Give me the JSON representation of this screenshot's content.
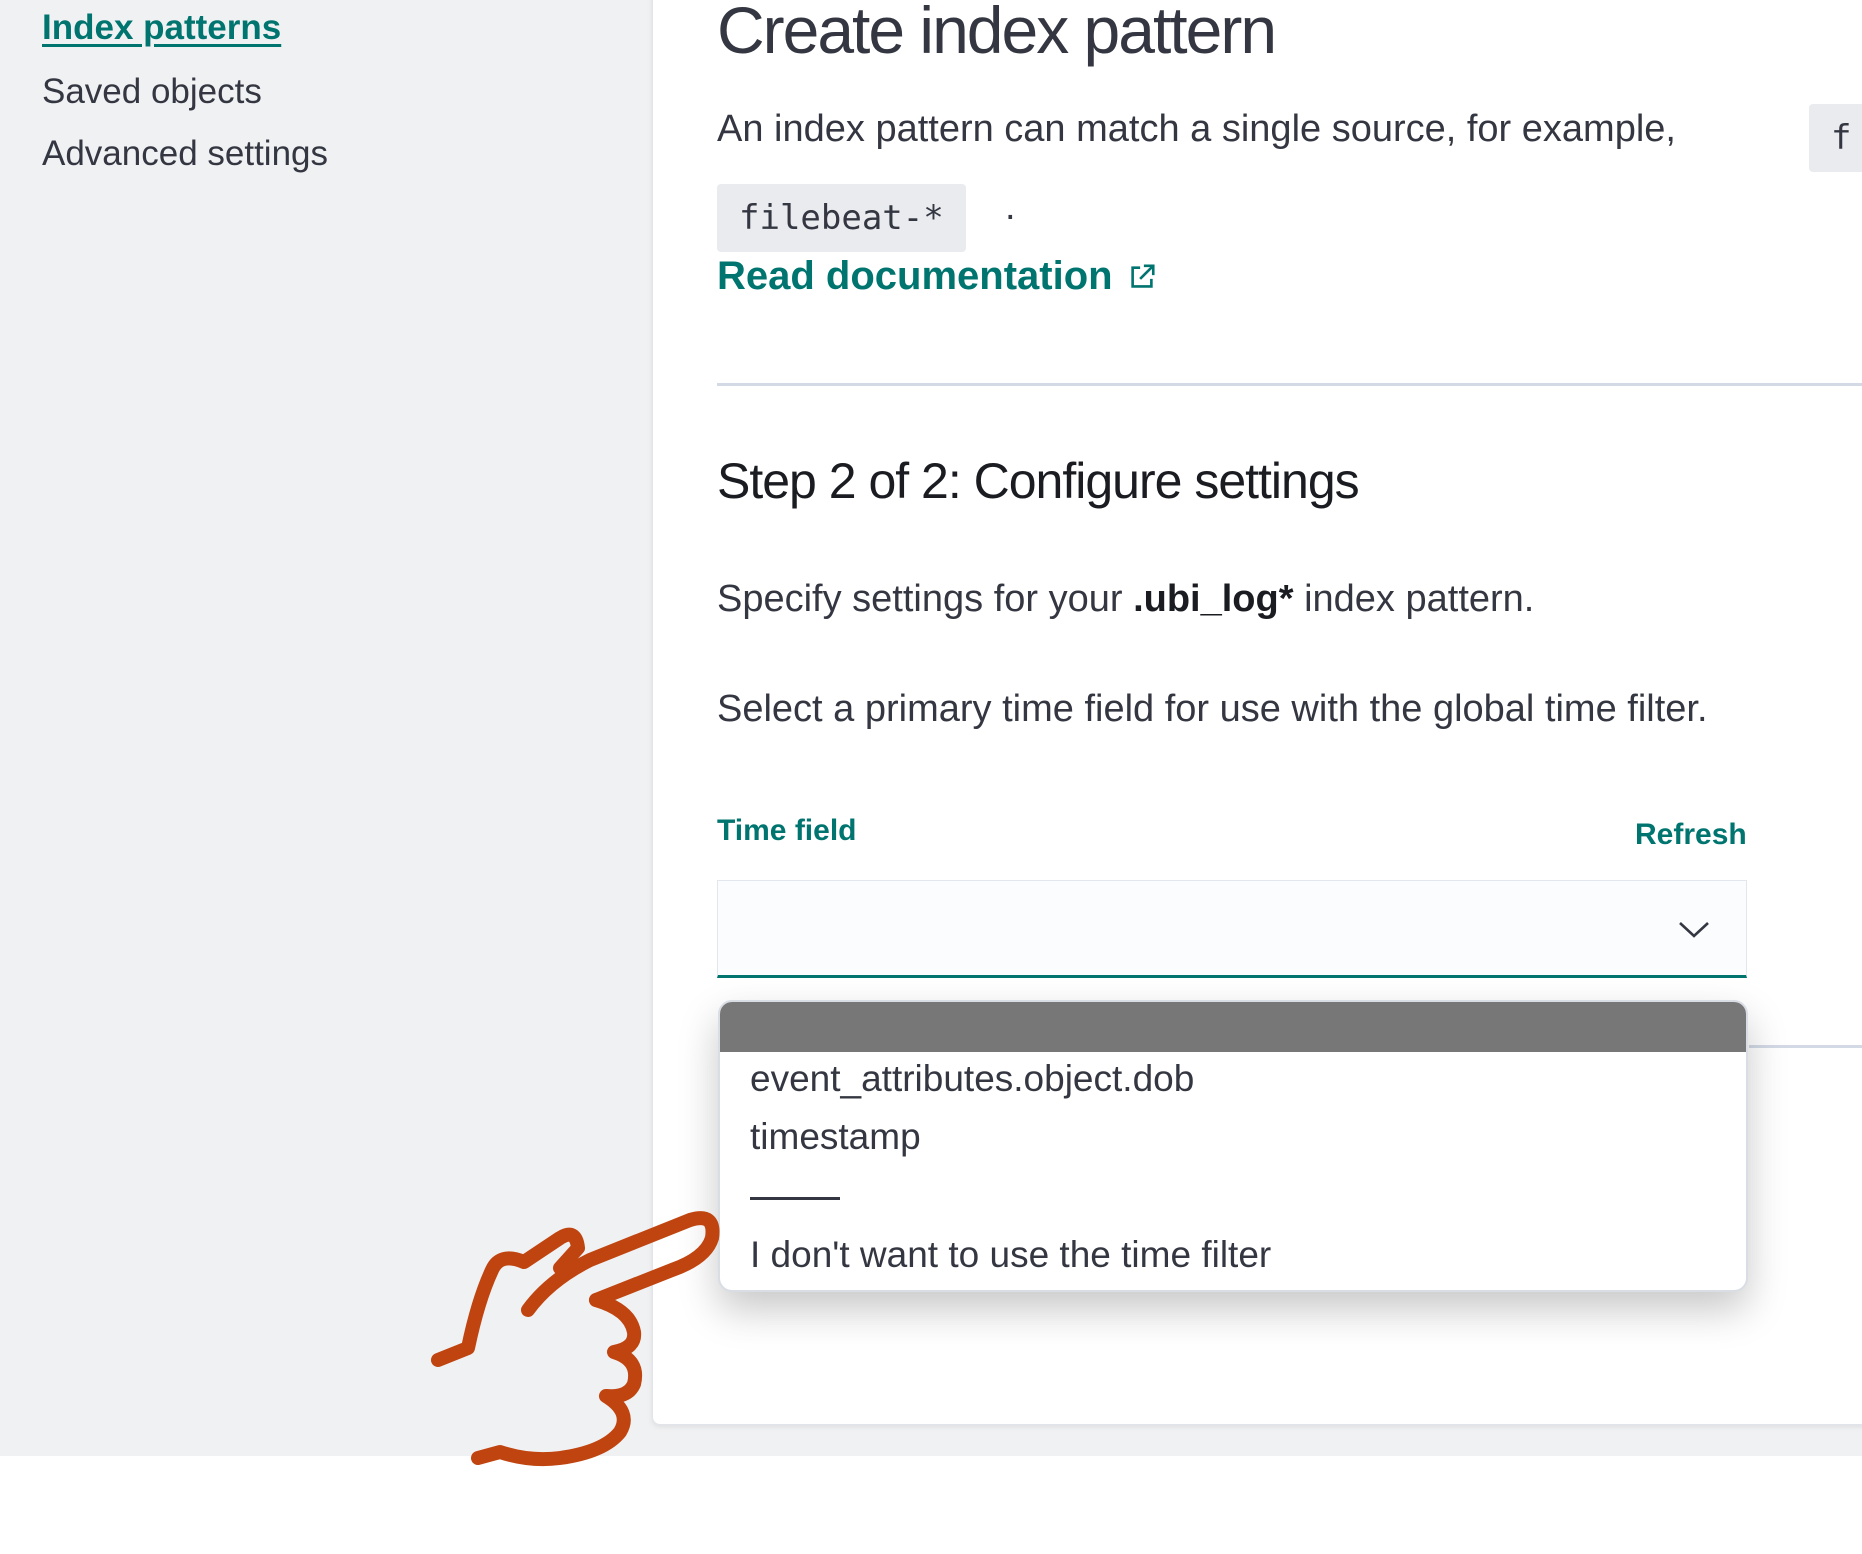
{
  "sidebar": {
    "items": [
      {
        "label": "Index patterns",
        "active": true
      },
      {
        "label": "Saved objects",
        "active": false
      },
      {
        "label": "Advanced settings",
        "active": false
      }
    ]
  },
  "main": {
    "title": "Create index pattern",
    "description": "An index pattern can match a single source, for example,",
    "code_example_1": "f",
    "code_example_2": "filebeat-*",
    "period": ".",
    "doc_link": "Read documentation",
    "step_title": "Step 2 of 2: Configure settings",
    "specify_prefix": "Specify settings for your ",
    "specify_pattern": ".ubi_log*",
    "specify_suffix": " index pattern.",
    "select_hint": "Select a primary time field for use with the global time filter."
  },
  "time_field": {
    "label": "Time field",
    "refresh_label": "Refresh",
    "value": ""
  },
  "dropdown": {
    "options": [
      "event_attributes.object.dob",
      "timestamp"
    ],
    "no_filter_option": "I don't want to use the time filter"
  },
  "colors": {
    "accent": "#00746f",
    "pointer_hand": "#c0440f",
    "dropdown_header": "#777777"
  }
}
